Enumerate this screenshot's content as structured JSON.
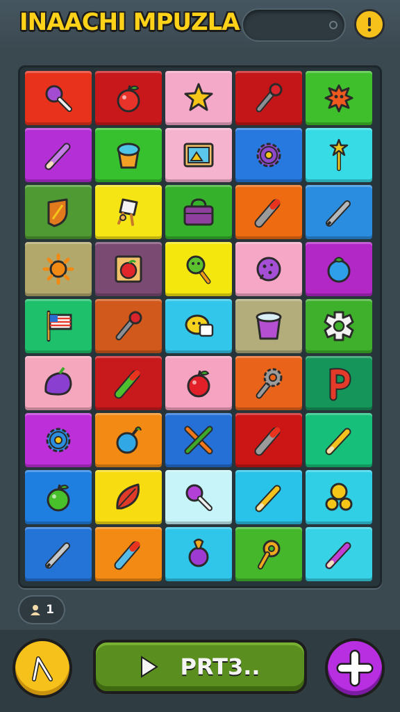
{
  "header": {
    "title": "INAACHI MPUZLA",
    "progress": 0
  },
  "level_badge": {
    "icon": "person-icon",
    "value": "1"
  },
  "footer": {
    "play_label": "PRT3..",
    "left_button_icon": "wand-icon",
    "right_button_icon": "plus-icon"
  },
  "grid": {
    "rows": [
      [
        {
          "icon": "magnifier",
          "color": "#e8321c",
          "fg": "#a34bd1"
        },
        {
          "icon": "apple",
          "color": "#c8181c",
          "fg": "#e8332a"
        },
        {
          "icon": "star",
          "color": "#f4a9c8",
          "fg": "#f5c518"
        },
        {
          "icon": "microphone",
          "color": "#c41518",
          "fg": "#8a8f93"
        },
        {
          "icon": "splat",
          "color": "#3fbf2b",
          "fg": "#f05a1e"
        }
      ],
      [
        {
          "icon": "pencil",
          "color": "#b52fd6",
          "fg": "#c57be6"
        },
        {
          "icon": "bucket",
          "color": "#37c12e",
          "fg": "#f2a124"
        },
        {
          "icon": "picture",
          "color": "#f6b3cd",
          "fg": "#8a5a2a"
        },
        {
          "icon": "gear",
          "color": "#2779e0",
          "fg": "#8d49c9"
        },
        {
          "icon": "wand",
          "color": "#36dbe6",
          "fg": "#e8c41e"
        }
      ],
      [
        {
          "icon": "shield",
          "color": "#4f9a32",
          "fg": "#e07a1c"
        },
        {
          "icon": "chair",
          "color": "#f6e514",
          "fg": "#f3f3f3"
        },
        {
          "icon": "bag",
          "color": "#36b12c",
          "fg": "#8f3f9e"
        },
        {
          "icon": "marker",
          "color": "#ef6b12",
          "fg": "#9b9b9b"
        },
        {
          "icon": "pen",
          "color": "#2b8de0",
          "fg": "#b4b8bb"
        }
      ],
      [
        {
          "icon": "sun",
          "color": "#b2a86c",
          "fg": "#f08a14"
        },
        {
          "icon": "apple-frame",
          "color": "#7a4a72",
          "fg": "#e0262a"
        },
        {
          "icon": "lollipop",
          "color": "#f4e70e",
          "fg": "#5cc12f"
        },
        {
          "icon": "cookie",
          "color": "#f7a7c6",
          "fg": "#a54fd6"
        },
        {
          "icon": "berry",
          "color": "#b128c7",
          "fg": "#2f9fea"
        }
      ],
      [
        {
          "icon": "flag",
          "color": "#1ec06c",
          "fg": "#e83a2a"
        },
        {
          "icon": "microphone",
          "color": "#d2591c",
          "fg": "#8a8f93"
        },
        {
          "icon": "chat",
          "color": "#31c6ea",
          "fg": "#f4d21e"
        },
        {
          "icon": "cup",
          "color": "#b3ad7c",
          "fg": "#b34fd0"
        },
        {
          "icon": "cog-outline",
          "color": "#3fb02c",
          "fg": "#f2f2f2"
        }
      ],
      [
        {
          "icon": "plum",
          "color": "#f5a7be",
          "fg": "#8a3fd0"
        },
        {
          "icon": "marker-green",
          "color": "#c81a1c",
          "fg": "#4fc12f"
        },
        {
          "icon": "apple",
          "color": "#f6a3c2",
          "fg": "#e2202a"
        },
        {
          "icon": "wrench",
          "color": "#e9631a",
          "fg": "#9b9b9b"
        },
        {
          "icon": "letter-p",
          "color": "#15955a",
          "fg": "#e43a2a"
        }
      ],
      [
        {
          "icon": "gear-blue",
          "color": "#bd30d9",
          "fg": "#2b8de0"
        },
        {
          "icon": "bomb",
          "color": "#f28a14",
          "fg": "#31a7e6"
        },
        {
          "icon": "tools",
          "color": "#2470d6",
          "fg": "#f2781a"
        },
        {
          "icon": "marker",
          "color": "#cc1616",
          "fg": "#9b9b9b"
        },
        {
          "icon": "pencil-yellow",
          "color": "#17c07a",
          "fg": "#f4c21e"
        }
      ],
      [
        {
          "icon": "apple-green",
          "color": "#1f7fe0",
          "fg": "#48c02c"
        },
        {
          "icon": "leaf",
          "color": "#f7dc12",
          "fg": "#e03a28"
        },
        {
          "icon": "magnifier",
          "color": "#c6f4f8",
          "fg": "#b23fd6"
        },
        {
          "icon": "pencil-yellow",
          "color": "#29c2e8",
          "fg": "#f4c21e"
        },
        {
          "icon": "ball-cluster",
          "color": "#31cfe6",
          "fg": "#f5c518"
        }
      ],
      [
        {
          "icon": "pen",
          "color": "#2474d8",
          "fg": "#c4c8cb"
        },
        {
          "icon": "marker-blue",
          "color": "#f28a14",
          "fg": "#57bde8"
        },
        {
          "icon": "ornament",
          "color": "#2fc6ea",
          "fg": "#9c3ad2"
        },
        {
          "icon": "key",
          "color": "#45b72b",
          "fg": "#f0a81e"
        },
        {
          "icon": "pencil-purple",
          "color": "#37d2e6",
          "fg": "#c23fd6"
        }
      ]
    ]
  }
}
